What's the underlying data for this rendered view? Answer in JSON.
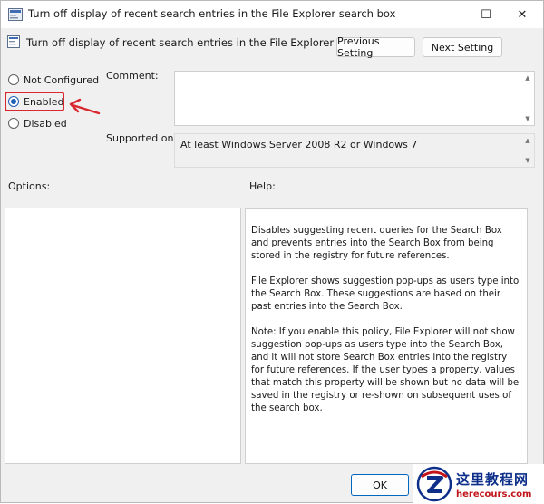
{
  "window": {
    "title": "Turn off display of recent search entries in the File Explorer search box",
    "controls": {
      "minimize": "—",
      "maximize": "☐",
      "close": "✕"
    }
  },
  "header": {
    "title": "Turn off display of recent search entries in the File Explorer search box",
    "prev_label": "Previous Setting",
    "next_label": "Next Setting"
  },
  "state": {
    "options": [
      {
        "label": "Not Configured",
        "checked": false
      },
      {
        "label": "Enabled",
        "checked": true
      },
      {
        "label": "Disabled",
        "checked": false
      }
    ]
  },
  "comment": {
    "label": "Comment:",
    "value": ""
  },
  "supported": {
    "label": "Supported on:",
    "value": "At least Windows Server 2008 R2 or Windows 7"
  },
  "options_label": "Options:",
  "help": {
    "label": "Help:",
    "paragraphs": [
      "Disables suggesting recent queries for the Search Box and prevents entries into the Search Box from being stored in the registry for future references.",
      "File Explorer shows suggestion pop-ups as users type into the Search Box.  These suggestions are based on their past entries into the Search Box.",
      "Note: If you enable this policy, File Explorer will not show suggestion pop-ups as users type into the Search Box, and it will not store Search Box entries into the registry for future references.  If the user types a property, values that match this property will be shown but no data will be saved in the registry or re-shown on subsequent uses of the search box."
    ]
  },
  "footer": {
    "ok_label": "OK",
    "cancel_label": ""
  },
  "watermark": {
    "cn": "这里教程网",
    "url": "herecours.com"
  },
  "colors": {
    "accent": "#1f5fb8",
    "highlight": "#d9282f"
  }
}
